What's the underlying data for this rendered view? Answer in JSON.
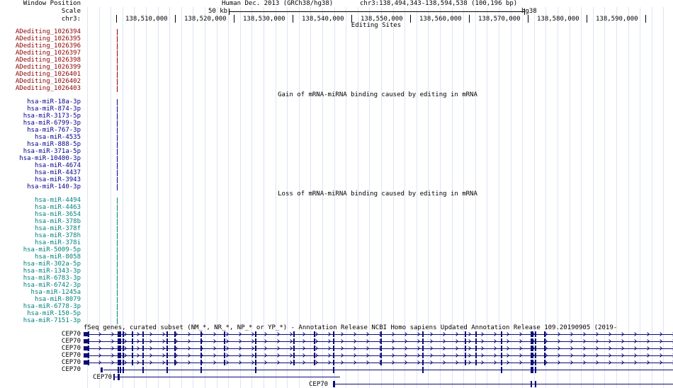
{
  "header": {
    "window_position_label": "Window Position",
    "scale_label": "Scale",
    "chr_label": "chr3:",
    "assembly": "Human Dec. 2013 (GRCh38/hg38)",
    "position": "chr3:138,494,343-138,594,538 (100,196 bp)",
    "scale_value": "50 kb",
    "scale_db": "hg38",
    "ticks": [
      "138,510,000",
      "138,520,000",
      "138,530,000",
      "138,540,000",
      "138,550,000",
      "138,560,000",
      "138,570,000",
      "138,580,000",
      "138,590,000"
    ]
  },
  "colors": {
    "editing": "#8b0000",
    "gain": "#00008b",
    "loss": "#008080",
    "gene": "#0c0c78",
    "grid": "#dde4f4"
  },
  "editing_track": {
    "title": "Editing Sites",
    "items": [
      "ADediting_1026394",
      "ADediting_1026395",
      "ADediting_1026396",
      "ADediting_1026397",
      "ADediting_1026398",
      "ADediting_1026399",
      "ADediting_1026401",
      "ADediting_1026402",
      "ADediting_1026403"
    ]
  },
  "gain_track": {
    "title": "Gain of mRNA-miRNA binding caused by editing in mRNA",
    "items": [
      "hsa-miR-18a-3p",
      "hsa-miR-874-3p",
      "hsa-miR-3173-5p",
      "hsa-miR-6799-3p",
      "hsa-miR-767-3p",
      "hsa-miR-4535",
      "hsa-miR-888-5p",
      "hsa-miR-371a-5p",
      "hsa-miR-10400-3p",
      "hsa-miR-4674",
      "hsa-miR-4437",
      "hsa-miR-3943",
      "hsa-miR-140-3p"
    ]
  },
  "loss_track": {
    "title": "Loss of mRNA-miRNA binding caused by editing in mRNA",
    "items": [
      "hsa-miR-4494",
      "hsa-miR-4463",
      "hsa-miR-3654",
      "hsa-miR-378b",
      "hsa-miR-378f",
      "hsa-miR-378h",
      "hsa-miR-378i",
      "hsa-miR-5009-5p",
      "hsa-miR-8058",
      "hsa-miR-302a-5p",
      "hsa-miR-1343-3p",
      "hsa-miR-6783-3p",
      "hsa-miR-6742-3p",
      "hsa-miR-1245a",
      "hsa-miR-8079",
      "hsa-miR-6778-3p",
      "hsa-miR-150-5p",
      "hsa-miR-7151-3p"
    ]
  },
  "refseq_track": {
    "title": "fSeq genes, curated subset (NM_*, NR_*, NP_* or YP_*) - Annotation Release NCBI Homo sapiens Updated Annotation Release 109.20190905 (2019-",
    "genes": [
      "CEP70",
      "CEP70",
      "CEP70",
      "CEP70",
      "CEP70",
      "CEP70"
    ],
    "inline_labels": [
      "CEP70",
      "CEP70"
    ]
  }
}
